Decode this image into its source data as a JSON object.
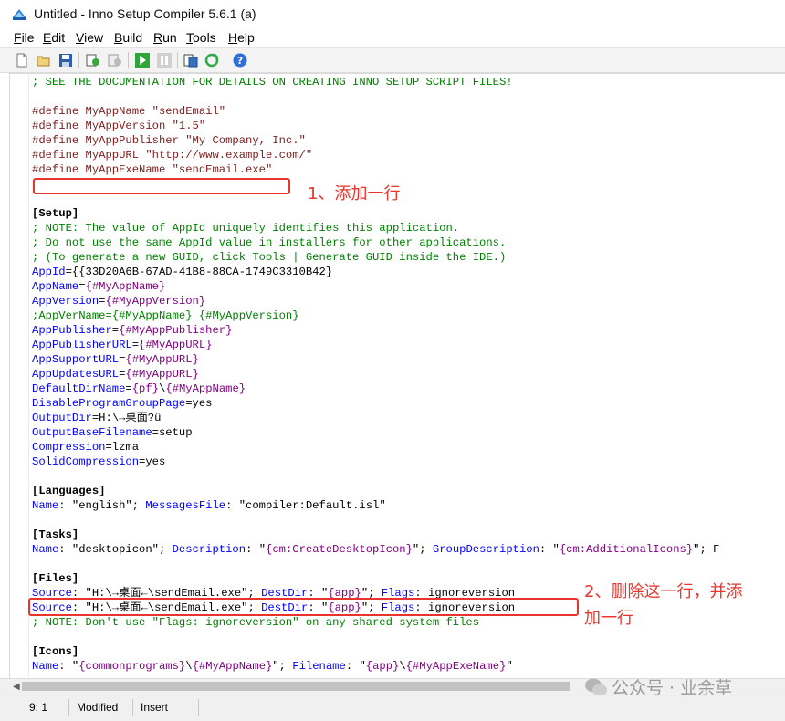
{
  "window": {
    "title": "Untitled - Inno Setup Compiler 5.6.1 (a)"
  },
  "menu": {
    "items": [
      {
        "first": "F",
        "rest": "ile"
      },
      {
        "first": "E",
        "rest": "dit"
      },
      {
        "first": "V",
        "rest": "iew"
      },
      {
        "first": "B",
        "rest": "uild"
      },
      {
        "first": "R",
        "rest": "un"
      },
      {
        "first": "T",
        "rest": "ools"
      },
      {
        "first": "H",
        "rest": "elp"
      }
    ]
  },
  "toolbar": {
    "icons": [
      "new-file-icon",
      "open-file-icon",
      "save-icon",
      "compile-icon",
      "stop-compile-icon",
      "run-icon",
      "pause-icon",
      "target-icon",
      "refresh-icon",
      "help-icon"
    ]
  },
  "code": {
    "l01": "; SEE THE DOCUMENTATION FOR DETAILS ON CREATING INNO SETUP SCRIPT FILES!",
    "d1_kw": "#define",
    "d1_rest": " MyAppName \"sendEmail\"",
    "d2_kw": "#define",
    "d2_rest": " MyAppVersion \"1.5\"",
    "d3_kw": "#define",
    "d3_rest": " MyAppPublisher \"My Company, Inc.\"",
    "d4_kw": "#define",
    "d4_rest": " MyAppURL \"http://www.example.com/\"",
    "d5_kw": "#define",
    "d5_rest": " MyAppExeName \"sendEmail.exe\"",
    "setup": "[Setup]",
    "n1": "; NOTE: The value of AppId uniquely identifies this application.",
    "n2": "; Do not use the same AppId value in installers for other applications.",
    "n3": "; (To generate a new GUID, click Tools | Generate GUID inside the IDE.)",
    "appid_k": "AppId",
    "appid_v": "={{33D20A6B-67AD-41B8-88CA-1749C3310B42}",
    "appname_k": "AppName",
    "appname_eq": "=",
    "appname_c": "{#MyAppName}",
    "appver_k": "AppVersion",
    "appver_eq": "=",
    "appver_c": "{#MyAppVersion}",
    "appvername": ";AppVerName={#MyAppName} {#MyAppVersion}",
    "apppub_k": "AppPublisher",
    "apppub_eq": "=",
    "apppub_c": "{#MyAppPublisher}",
    "apppuburl_k": "AppPublisherURL",
    "apppuburl_eq": "=",
    "apppuburl_c": "{#MyAppURL}",
    "appsup_k": "AppSupportURL",
    "appsup_eq": "=",
    "appsup_c": "{#MyAppURL}",
    "appupd_k": "AppUpdatesURL",
    "appupd_eq": "=",
    "appupd_c": "{#MyAppURL}",
    "defdir_k": "DefaultDirName",
    "defdir_eq": "=",
    "defdir_c1": "{pf}",
    "defdir_sep": "\\",
    "defdir_c2": "{#MyAppName}",
    "dpg_k": "DisableProgramGroupPage",
    "dpg_v": "=yes",
    "outdir_k": "OutputDir",
    "outdir_v": "=H:\\→桌面?û",
    "outbase_k": "OutputBaseFilename",
    "outbase_v": "=setup",
    "comp_k": "Compression",
    "comp_v": "=lzma",
    "solid_k": "SolidCompression",
    "solid_v": "=yes",
    "languages": "[Languages]",
    "lang_k1": "Name",
    "lang_v1": ": \"english\"; ",
    "lang_k2": "MessagesFile",
    "lang_v2": ": \"compiler:Default.isl\"",
    "tasks": "[Tasks]",
    "task_k1": "Name",
    "task_v1": ": \"desktopicon\"; ",
    "task_k2": "Description",
    "task_v2a": ": \"",
    "task_c1": "{cm:CreateDesktopIcon}",
    "task_v2b": "\"; ",
    "task_k3": "GroupDescription",
    "task_v3a": ": \"",
    "task_c2": "{cm:AdditionalIcons}",
    "task_v3b": "\"; F",
    "files": "[Files]",
    "f_src": "Source",
    "f1_v": ": \"H:\\→桌面←\\sendEmail.exe\"; ",
    "f_dest": "DestDir",
    "f_dest_a": ": \"",
    "f_app": "{app}",
    "f_dest_b": "\"; ",
    "f_flags": "Flags",
    "f_flags_v": ": ignoreversion",
    "f2_v": ": \"H:\\→桌面←\\sendEmail.exe\"; ",
    "fnote": "; NOTE: Don't use \"Flags: ignoreversion\" on any shared system files",
    "icons": "[Icons]",
    "i_name": "Name",
    "i_v1": ": \"",
    "i_c1": "{commonprograms}",
    "i_sep": "\\",
    "i_c2": "{#MyAppName}",
    "i_v2": "\"; ",
    "i_file": "Filename",
    "i_v3": ": \"",
    "i_c3": "{app}",
    "i_sep2": "\\",
    "i_c4": "{#MyAppExeName}",
    "i_v4": "\""
  },
  "annotations": {
    "note1": "1、添加一行",
    "note2_line1": "2、删除这一行，并添",
    "note2_line2": "加一行"
  },
  "status": {
    "position": "9:  1",
    "modified": "Modified",
    "mode": "Insert"
  },
  "watermark": "公众号 · 业余草"
}
